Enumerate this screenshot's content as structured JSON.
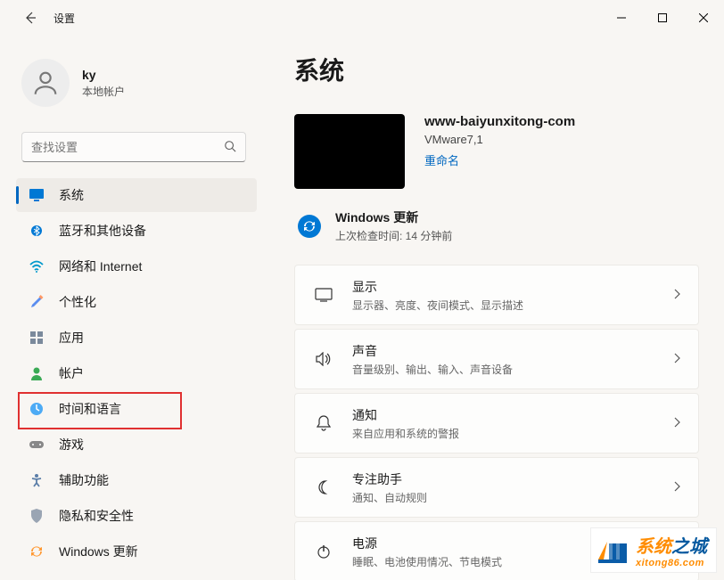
{
  "window": {
    "title": "设置"
  },
  "account": {
    "name": "ky",
    "type": "本地帐户"
  },
  "search": {
    "placeholder": "查找设置"
  },
  "sidebar": {
    "items": [
      {
        "label": "系统"
      },
      {
        "label": "蓝牙和其他设备"
      },
      {
        "label": "网络和 Internet"
      },
      {
        "label": "个性化"
      },
      {
        "label": "应用"
      },
      {
        "label": "帐户"
      },
      {
        "label": "时间和语言"
      },
      {
        "label": "游戏"
      },
      {
        "label": "辅助功能"
      },
      {
        "label": "隐私和安全性"
      },
      {
        "label": "Windows 更新"
      }
    ]
  },
  "page": {
    "title": "系统",
    "device": {
      "name": "www-baiyunxitong-com",
      "model": "VMware7,1",
      "rename": "重命名"
    },
    "update": {
      "title": "Windows 更新",
      "sub": "上次检查时间: 14 分钟前"
    },
    "settings": [
      {
        "title": "显示",
        "sub": "显示器、亮度、夜间模式、显示描述"
      },
      {
        "title": "声音",
        "sub": "音量级别、输出、输入、声音设备"
      },
      {
        "title": "通知",
        "sub": "来自应用和系统的警报"
      },
      {
        "title": "专注助手",
        "sub": "通知、自动规则"
      },
      {
        "title": "电源",
        "sub": "睡眠、电池使用情况、节电模式"
      }
    ]
  },
  "watermark": {
    "text1": "系统",
    "text2": "之城",
    "url": "xitong86.com"
  }
}
